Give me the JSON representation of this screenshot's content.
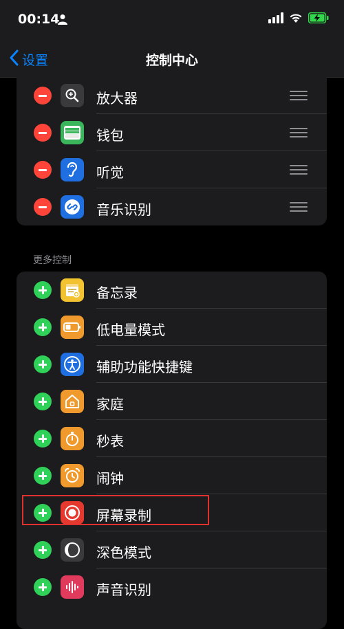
{
  "status_bar": {
    "time": "00:14"
  },
  "nav": {
    "back_label": "设置",
    "title": "控制中心"
  },
  "included_controls": [
    {
      "label": "放大器",
      "icon": "magnifier-icon",
      "color": "#3a3a3c"
    },
    {
      "label": "钱包",
      "icon": "wallet-icon",
      "color": "#3ab55c"
    },
    {
      "label": "听觉",
      "icon": "ear-icon",
      "color": "#1f6fe0"
    },
    {
      "label": "音乐识别",
      "icon": "shazam-icon",
      "color": "#1f6fe0"
    }
  ],
  "more_controls": {
    "header": "更多控制",
    "items": [
      {
        "label": "备忘录",
        "icon": "notes-icon",
        "color": "#f2c230"
      },
      {
        "label": "低电量模式",
        "icon": "battery-icon",
        "color": "#f09a2e"
      },
      {
        "label": "辅助功能快捷键",
        "icon": "accessibility-icon",
        "color": "#1f6fe0"
      },
      {
        "label": "家庭",
        "icon": "home-icon",
        "color": "#f09a2e"
      },
      {
        "label": "秒表",
        "icon": "stopwatch-icon",
        "color": "#f09a2e"
      },
      {
        "label": "闹钟",
        "icon": "alarm-icon",
        "color": "#f09a2e"
      },
      {
        "label": "屏幕录制",
        "icon": "screen-record-icon",
        "color": "#e5392f"
      },
      {
        "label": "深色模式",
        "icon": "dark-mode-icon",
        "color": "#3a3a3c"
      },
      {
        "label": "声音识别",
        "icon": "sound-recognition-icon",
        "color": "#e03a5c"
      }
    ]
  },
  "colors": {
    "accent": "#0a84ff",
    "remove": "#ff453a",
    "add": "#30d158",
    "highlight": "#e0312e"
  }
}
